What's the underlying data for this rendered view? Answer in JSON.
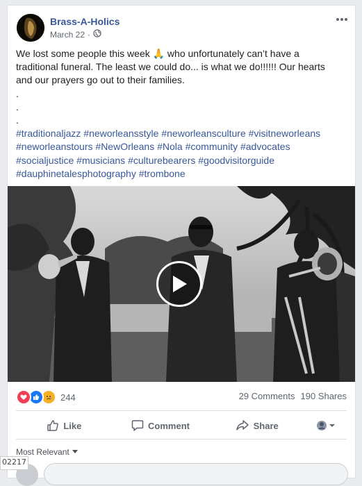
{
  "post": {
    "page_name": "Brass-A-Holics",
    "date": "March 22",
    "privacy_icon": "globe-icon",
    "text_lines": [
      "We lost some people this week 🙏 who unfortunately can’t have a",
      "traditional funeral. The least we could do... is what we do!!!!!! Our hearts",
      "and our prayers go out to their families.",
      ".",
      ".",
      "."
    ],
    "hashtag_lines": [
      [
        "#traditionaljazz",
        "#neworleansstyle",
        "#neworleansculture",
        "#visitneworleans"
      ],
      [
        "#neworleanstours",
        "#NewOrleans",
        "#Nola",
        "#community",
        "#advocates"
      ],
      [
        "#socialjustice",
        "#musicians",
        "#culturebearers",
        "#goodvisitorguide"
      ],
      [
        "#dauphinetalesphotography",
        "#trombone"
      ]
    ]
  },
  "video": {
    "play_icon": "play-icon"
  },
  "stats": {
    "reactions": [
      "love",
      "like",
      "sad"
    ],
    "reaction_count": "244",
    "comments": "29 Comments",
    "shares": "190 Shares"
  },
  "actions": {
    "like": "Like",
    "comment": "Comment",
    "share": "Share"
  },
  "comments": {
    "sort_label": "Most Relevant"
  },
  "overlay": {
    "label": "02217"
  },
  "colors": {
    "link": "#385898",
    "love": "#f33e58",
    "like": "#1877f2",
    "sad": "#f7b125"
  }
}
